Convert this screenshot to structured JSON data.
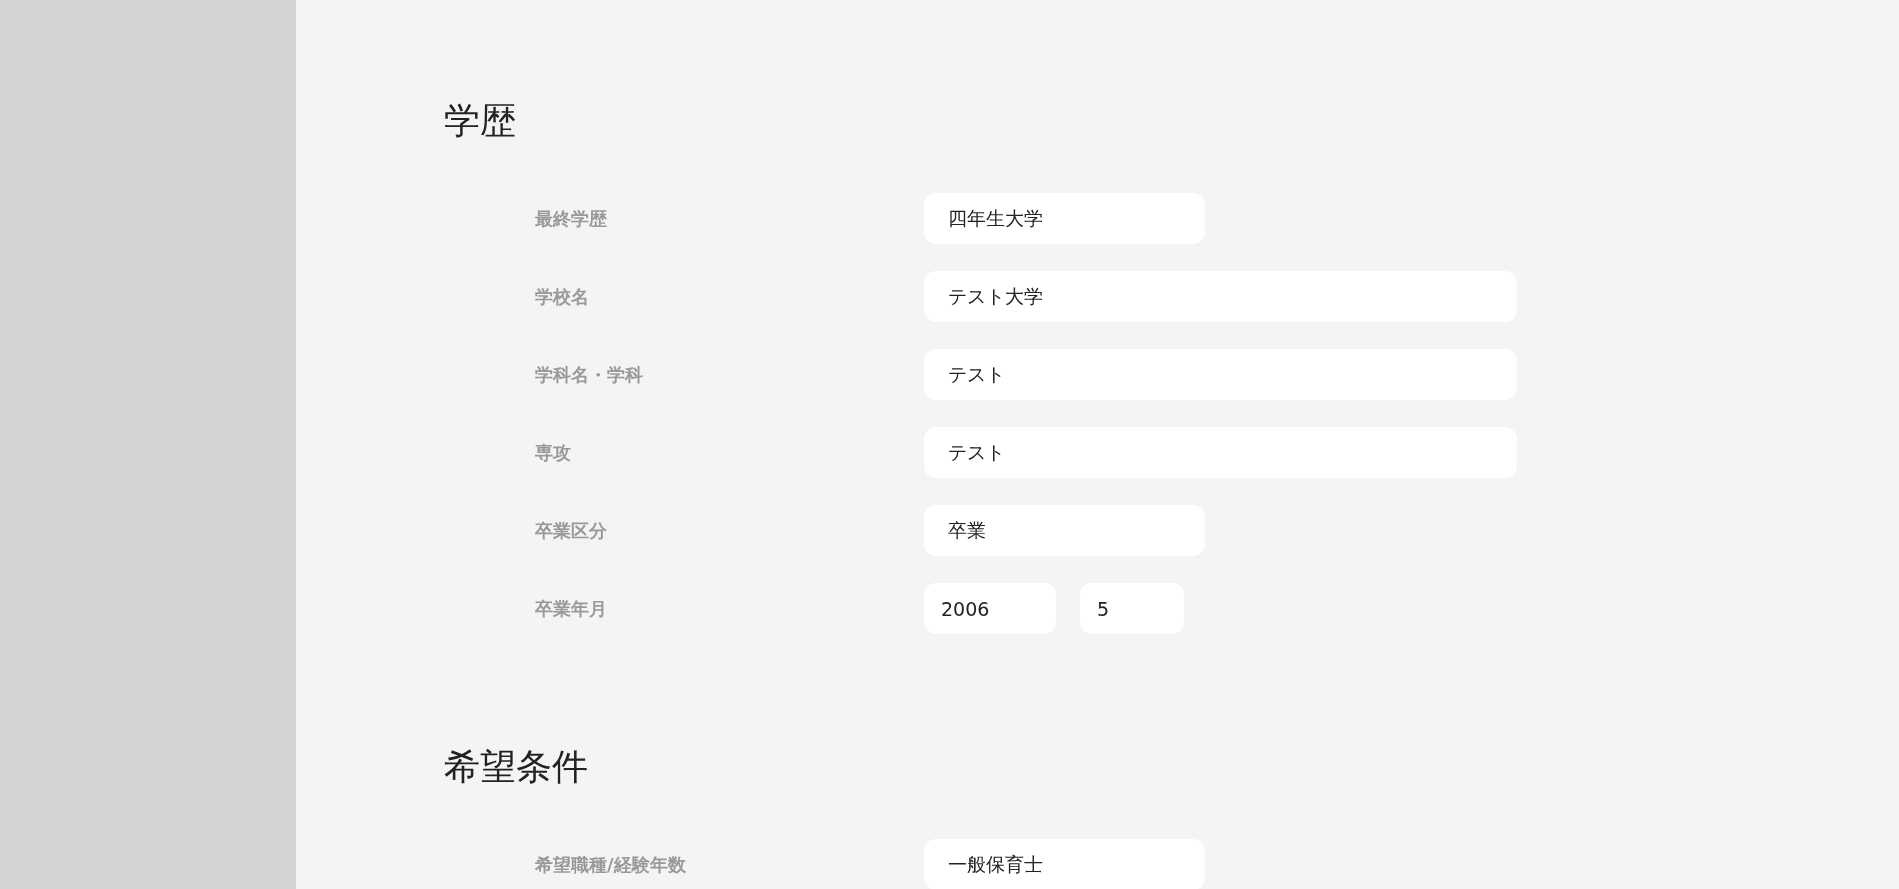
{
  "sections": [
    {
      "title": "学歴",
      "fields": [
        {
          "label": "最終学歴",
          "inputs": [
            {
              "kind": "short",
              "value": "四年生大学"
            }
          ]
        },
        {
          "label": "学校名",
          "inputs": [
            {
              "kind": "wide",
              "value": "テスト大学"
            }
          ]
        },
        {
          "label": "学科名・学科",
          "inputs": [
            {
              "kind": "wide",
              "value": "テスト"
            }
          ]
        },
        {
          "label": "専攻",
          "inputs": [
            {
              "kind": "wide",
              "value": "テスト"
            }
          ]
        },
        {
          "label": "卒業区分",
          "inputs": [
            {
              "kind": "short",
              "value": "卒業"
            }
          ]
        },
        {
          "label": "卒業年月",
          "inputs": [
            {
              "kind": "year",
              "value": "2006"
            },
            {
              "kind": "month",
              "value": "5"
            }
          ]
        }
      ]
    },
    {
      "title": "希望条件",
      "fields": [
        {
          "label": "希望職種/経験年数",
          "inputs": [
            {
              "kind": "short",
              "value": "一般保育士"
            }
          ]
        }
      ]
    }
  ]
}
